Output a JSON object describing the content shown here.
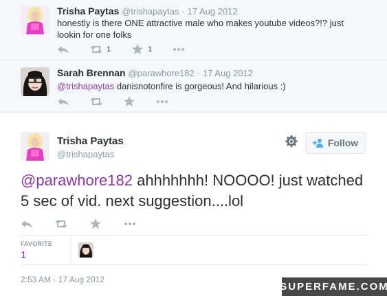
{
  "tweets": [
    {
      "name": "Trisha Paytas",
      "handle": "@trishapaytas",
      "sep": "·",
      "time": "17 Aug 2012",
      "text": "honestly is there ONE attractive male who makes youtube videos?!? just lookin for one folks",
      "retweets": "1",
      "favorites": "1"
    },
    {
      "name": "Sarah Brennan",
      "handle": "@parawhore182",
      "sep": "·",
      "time": "17 Aug 2012",
      "mention": "@trishapaytas",
      "text": " danisnotonfire is gorgeous! And hilarious :)"
    }
  ],
  "main": {
    "name": "Trisha Paytas",
    "handle": "@trishapaytas",
    "follow_label": "Follow",
    "mention": "@parawhore182",
    "text": " ahhhhhhh! NOOOO! just watched 5 sec of vid. next suggestion....lol",
    "favorite_label": "FAVORITE",
    "favorite_count": "1",
    "timestamp": "2:53 AM - 17 Aug 2012"
  },
  "watermark": "SUPERFAME.COM",
  "colors": {
    "mention": "#8a3a9c",
    "muted": "#8899a6",
    "thread_bg": "#f5f8fa"
  },
  "icons": [
    "reply-icon",
    "retweet-icon",
    "favorite-icon",
    "more-icon",
    "gear-icon",
    "follow-person-icon"
  ]
}
